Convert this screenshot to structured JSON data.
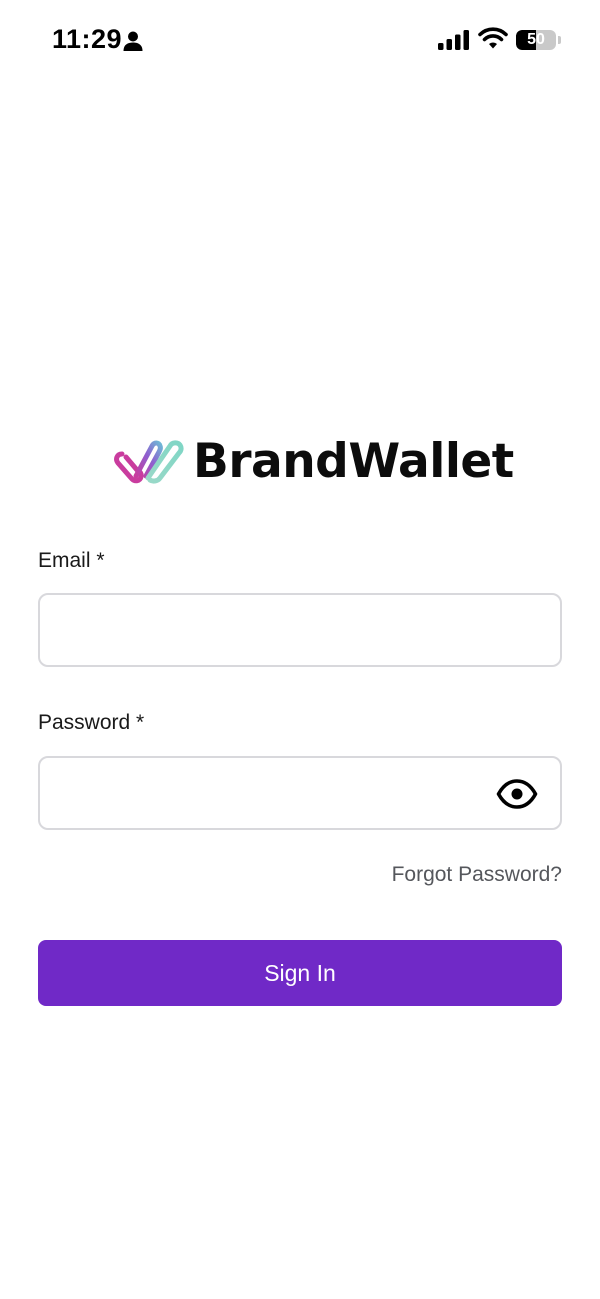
{
  "status_bar": {
    "time": "11:29",
    "battery_level": "50",
    "battery_fraction": 0.5,
    "icons": [
      "person-icon",
      "signal-icon",
      "wifi-icon",
      "battery-icon"
    ]
  },
  "brand": {
    "name": "BrandWallet",
    "logo_icon": "brand-logo-mark",
    "logo_colors": [
      "#c93c9e",
      "#6d5bd0",
      "#7fd6c5"
    ]
  },
  "form": {
    "email_label": "Email *",
    "email_value": "",
    "password_label": "Password *",
    "password_value": "",
    "password_toggle_icon": "eye-icon",
    "forgot_password": "Forgot Password?",
    "sign_in": "Sign In"
  },
  "colors": {
    "primary": "#7029c7",
    "link": "#55575c",
    "input_border": "#d8d8dc"
  }
}
